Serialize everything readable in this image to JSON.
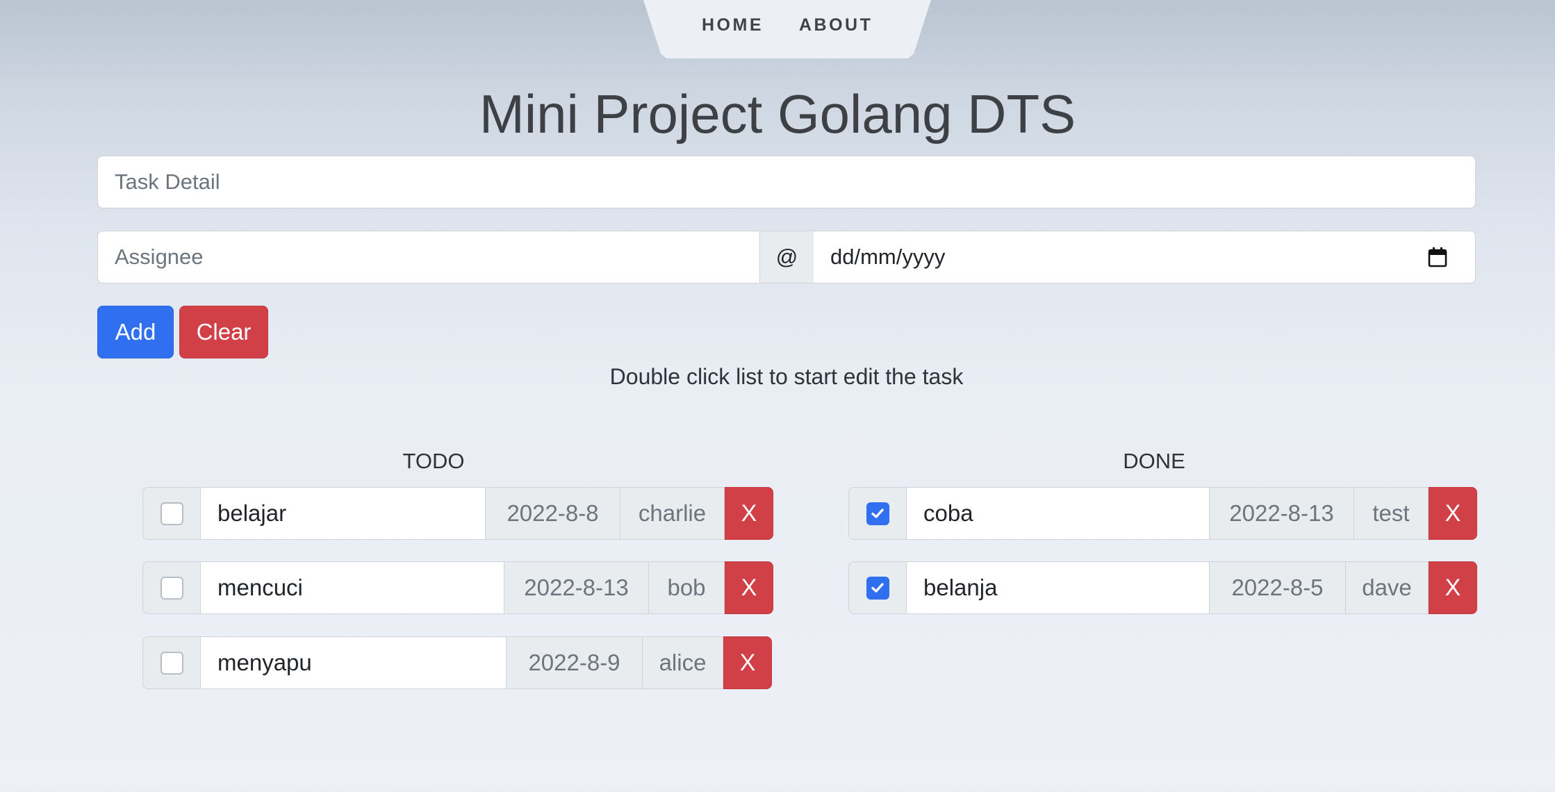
{
  "nav": {
    "home": "HOME",
    "about": "ABOUT"
  },
  "page": {
    "title": "Mini Project Golang DTS",
    "hint": "Double click list to start edit the task"
  },
  "form": {
    "task_placeholder": "Task Detail",
    "assignee_placeholder": "Assignee",
    "at_symbol": "@",
    "date_placeholder": "dd/mm/yyyy",
    "add_label": "Add",
    "clear_label": "Clear"
  },
  "lists": {
    "todo": {
      "heading": "TODO",
      "items": [
        {
          "task": "belajar",
          "date": "2022-8-8",
          "assignee": "charlie",
          "done": false,
          "delete": "X"
        },
        {
          "task": "mencuci",
          "date": "2022-8-13",
          "assignee": "bob",
          "done": false,
          "delete": "X"
        },
        {
          "task": "menyapu",
          "date": "2022-8-9",
          "assignee": "alice",
          "done": false,
          "delete": "X"
        }
      ]
    },
    "done": {
      "heading": "DONE",
      "items": [
        {
          "task": "coba",
          "date": "2022-8-13",
          "assignee": "test",
          "done": true,
          "delete": "X"
        },
        {
          "task": "belanja",
          "date": "2022-8-5",
          "assignee": "dave",
          "done": true,
          "delete": "X"
        }
      ]
    }
  },
  "colors": {
    "primary": "#2f6ff0",
    "danger": "#d13f47",
    "addon_bg": "#e9ecef"
  },
  "icons": {
    "date": "calendar-icon",
    "checked": "checkmark-icon"
  }
}
